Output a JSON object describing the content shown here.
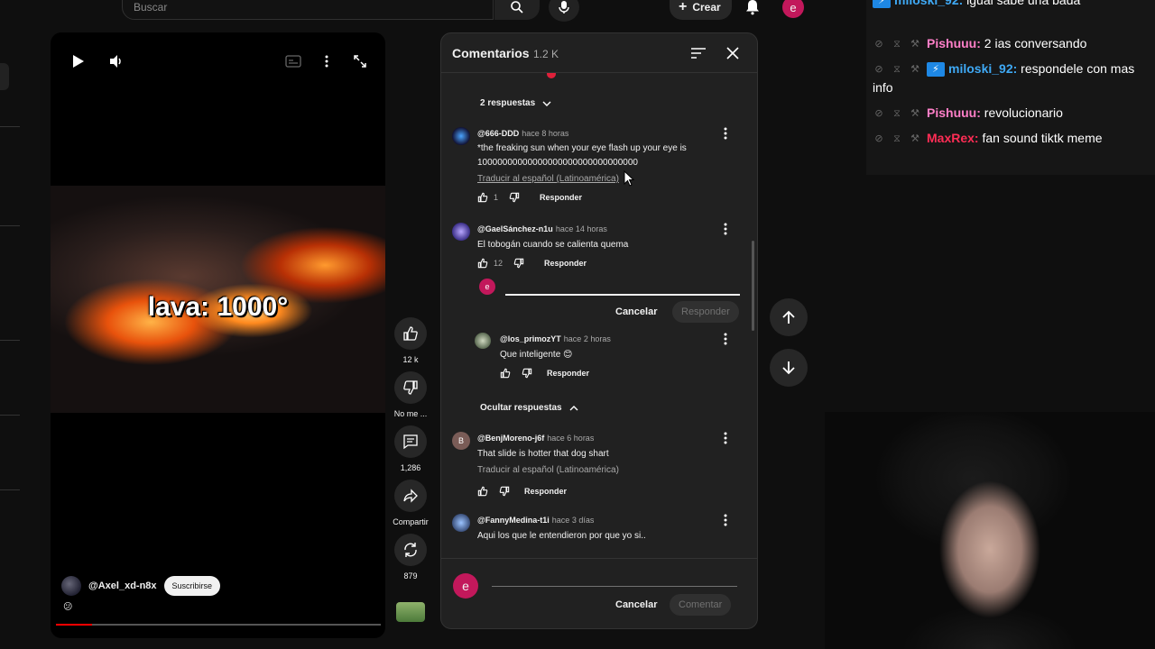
{
  "topbar": {
    "search_placeholder": "Buscar",
    "create_label": "Crear",
    "user_initial": "e"
  },
  "video": {
    "overlay_text": "lava: 1000°",
    "channel_name": "@Axel_xd-n8x",
    "subscribe_label": "Suscribirse",
    "caption_emoji": "😕",
    "progress": 0.11
  },
  "rail": {
    "likes": "12 k",
    "dislike_label": "No me ...",
    "comments_count": "1,286",
    "share_label": "Compartir",
    "remix_count": "879"
  },
  "comments_panel": {
    "title": "Comentarios",
    "count": "1.2 K",
    "show_replies_label": "2 respuestas",
    "hide_replies_label": "Ocultar respuestas",
    "reply_label": "Responder",
    "cancel_label": "Cancelar",
    "comment_label": "Comentar",
    "translate_label": "Traducir al español (Latinoamérica)",
    "comments": [
      {
        "user": "@666-DDD",
        "time": "hace 8 horas",
        "text_line1": "*the freaking sun when your eye flash up your eye is",
        "text_line2": "10000000000000000000000000000000",
        "likes": "1"
      },
      {
        "user": "@GaelSánchez-n1u",
        "time": "hace 14 horas",
        "text_line1": "El tobogán cuando se calienta quema",
        "likes": "12"
      },
      {
        "user": "@los_primozYT",
        "time": "hace 2 horas",
        "text_line1": "Que inteligente 😊"
      },
      {
        "user": "@BenjMoreno-j6f",
        "time": "hace 6 horas",
        "avatar_letter": "B",
        "text_line1": "That slide is hotter that dog shart"
      },
      {
        "user": "@FannyMedina-t1i",
        "time": "hace 3 días",
        "text_line1": "Aqui los que le entendieron por que yo si.."
      }
    ]
  },
  "chat": {
    "messages": [
      {
        "user": "miloski_92:",
        "text": "igual sabe una bada",
        "color": "#3fa9f5",
        "badge": true
      },
      {
        "user": "Pishuuu:",
        "text": "2 ias conversando",
        "color": "#ff7fc8",
        "badge": false
      },
      {
        "user": "miloski_92:",
        "text": "respondele con mas info",
        "color": "#3fa9f5",
        "badge": true
      },
      {
        "user": "Pishuuu:",
        "text": "revolucionario",
        "color": "#ff7fc8",
        "badge": false
      },
      {
        "user": "MaxRex:",
        "text": "fan sound tiktk meme",
        "color": "#ff2d55",
        "badge": false
      }
    ]
  },
  "colors": {
    "accent_red": "#ff0000",
    "avatar_pink": "#c2185b"
  }
}
